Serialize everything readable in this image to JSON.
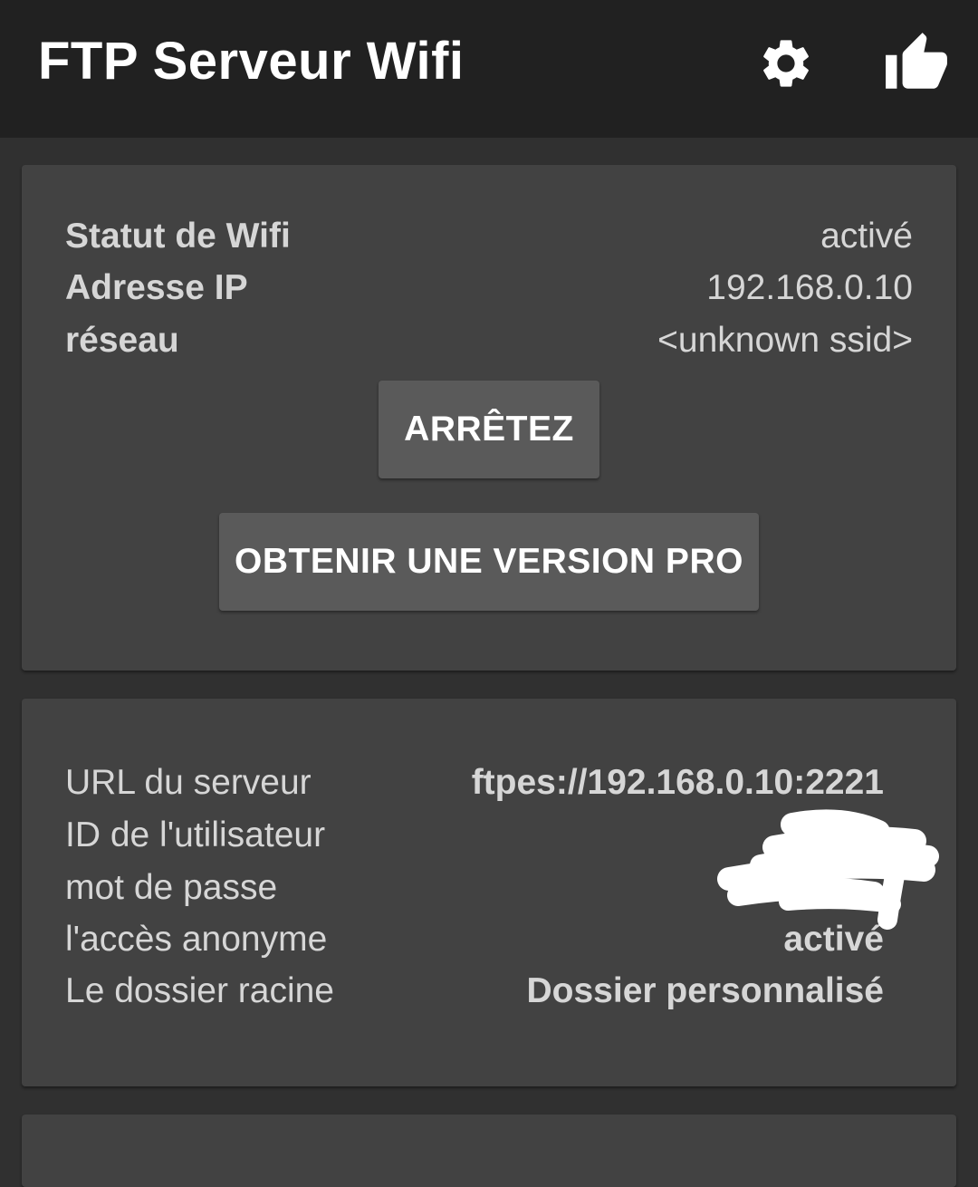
{
  "app_bar": {
    "title": "FTP Serveur Wifi",
    "actions": [
      {
        "icon": "gear-icon"
      },
      {
        "icon": "thumb-up-icon"
      }
    ]
  },
  "wifi_card": {
    "rows": [
      {
        "label": "Statut de Wifi",
        "value": "activé"
      },
      {
        "label": "Adresse IP",
        "value": "192.168.0.10"
      },
      {
        "label": "réseau",
        "value": "<unknown ssid>"
      }
    ],
    "stop_button": "ARRÊTEZ",
    "pro_button": "OBTENIR UNE VERSION PRO"
  },
  "server_card": {
    "rows": [
      {
        "label": "URL du serveur",
        "value": "ftpes://192.168.0.10:2221"
      },
      {
        "label": "ID de l'utilisateur",
        "value": ""
      },
      {
        "label": "mot de passe",
        "value": ""
      },
      {
        "label": "l'accès anonyme",
        "value": "activé"
      },
      {
        "label": "Le dossier racine",
        "value": "Dossier personnalisé"
      }
    ]
  },
  "colors": {
    "app_bar_bg": "#212121",
    "background": "#303030",
    "card_bg": "#424242",
    "button_bg": "#5a5a5a",
    "text": "#d6d6d6"
  }
}
